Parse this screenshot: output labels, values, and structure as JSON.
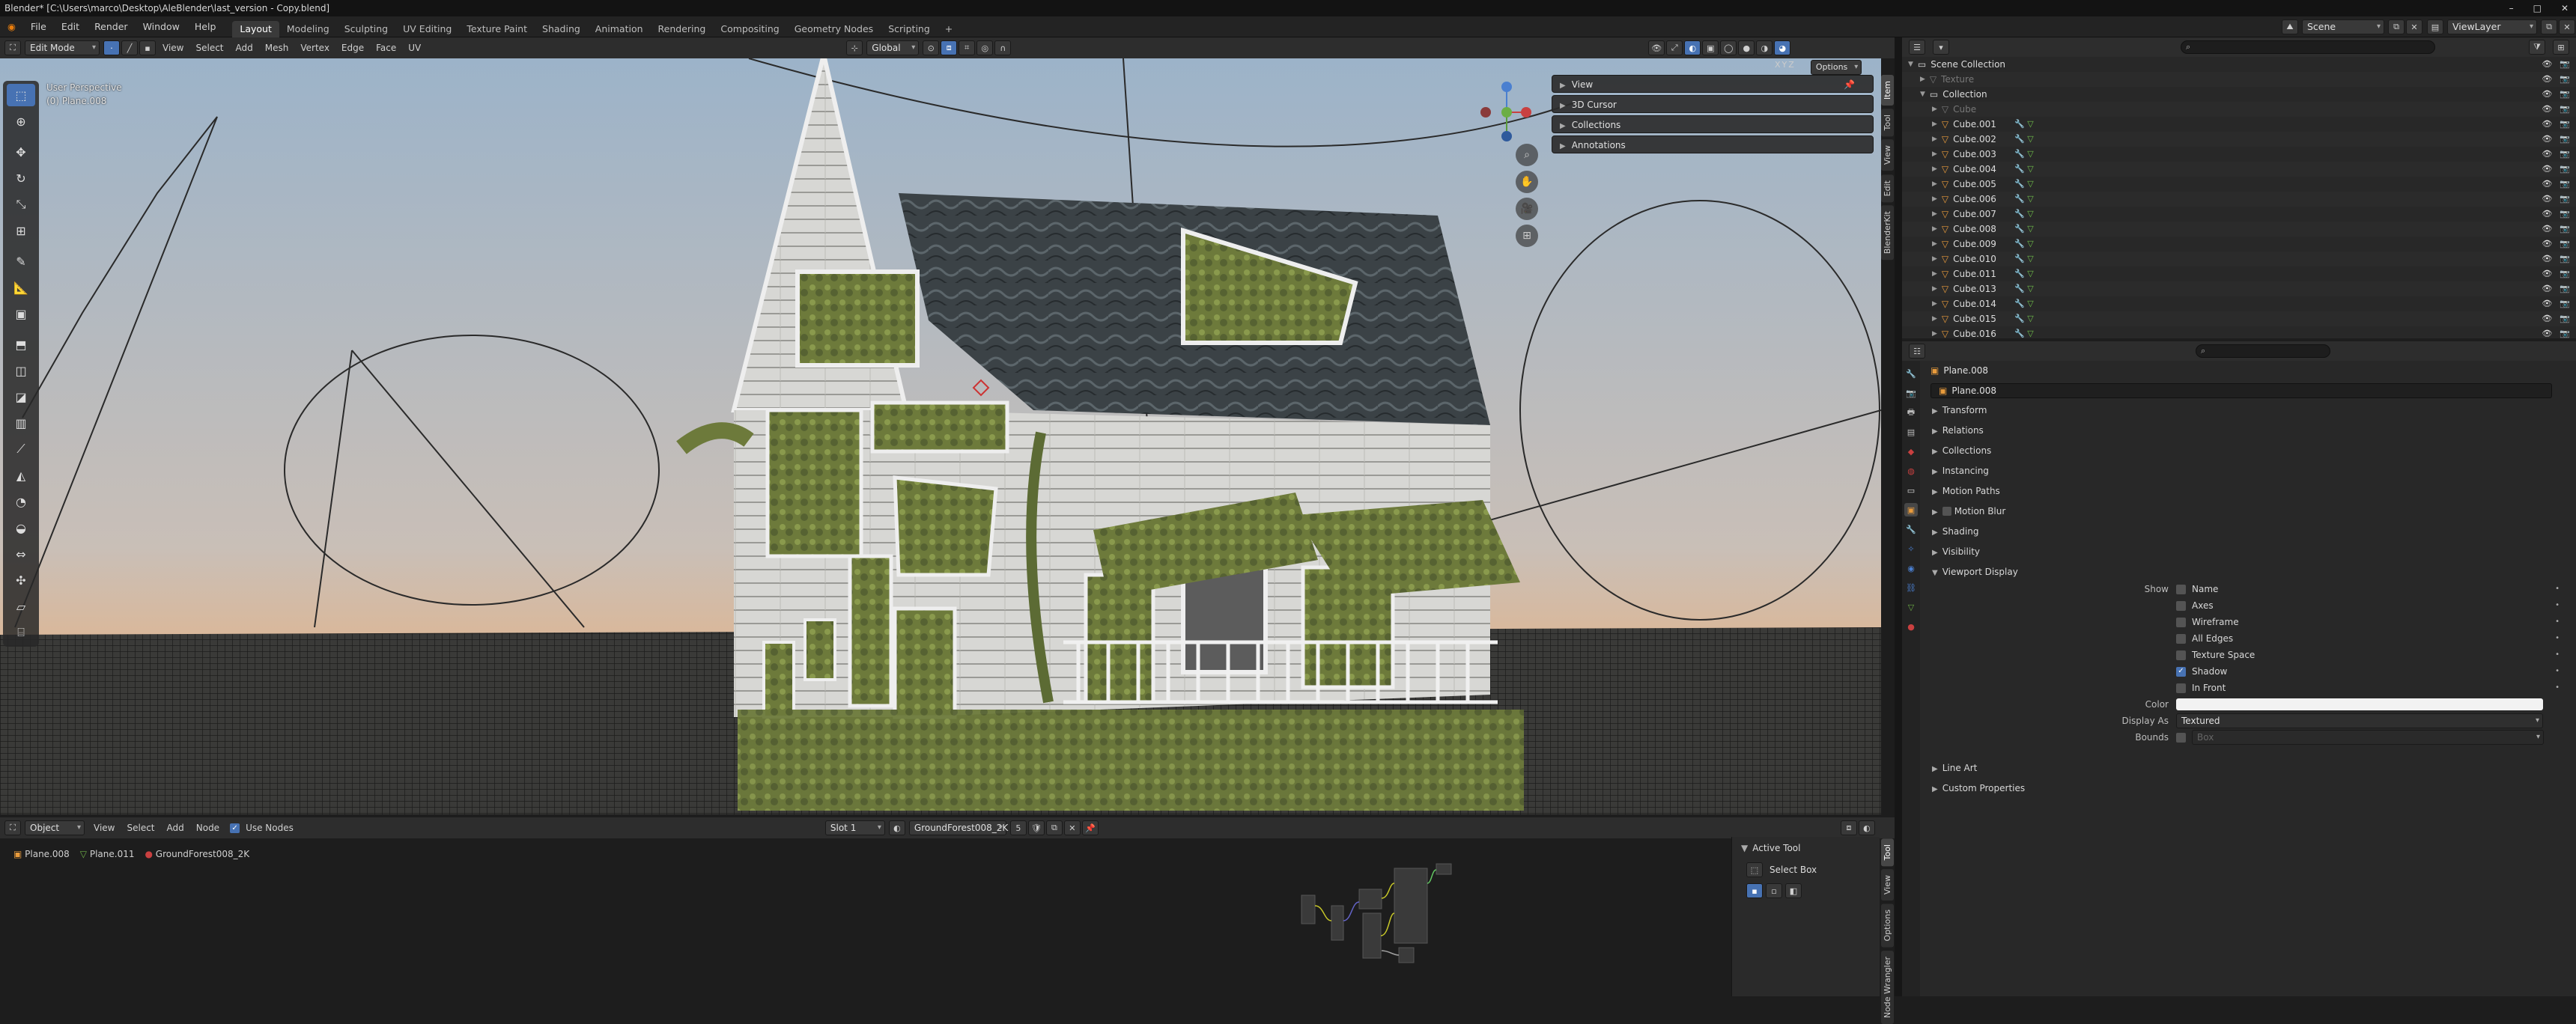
{
  "window": {
    "title": "Blender* [C:\\Users\\marco\\Desktop\\AleBlender\\last_version - Copy.blend]",
    "controls": [
      "–",
      "□",
      "✕"
    ]
  },
  "menu": [
    "File",
    "Edit",
    "Render",
    "Window",
    "Help"
  ],
  "workspaces": [
    "Layout",
    "Modeling",
    "Sculpting",
    "UV Editing",
    "Texture Paint",
    "Shading",
    "Animation",
    "Rendering",
    "Compositing",
    "Geometry Nodes",
    "Scripting",
    "+"
  ],
  "scene": {
    "scene_name": "Scene",
    "view_layer": "ViewLayer"
  },
  "viewport_header": {
    "mode": "Edit Mode",
    "menus": [
      "View",
      "Select",
      "Add",
      "Mesh",
      "Vertex",
      "Edge",
      "Face",
      "UV"
    ],
    "orientation": "Global",
    "options_label": "Options",
    "axes": [
      "X",
      "Y",
      "Z"
    ]
  },
  "viewport": {
    "view_name": "User Perspective",
    "object_label": "(0) Plane.008",
    "npanels": [
      "View",
      "3D Cursor",
      "Collections",
      "Annotations"
    ],
    "side_tabs": [
      "Item",
      "Tool",
      "View",
      "Edit",
      "BlenderKit"
    ]
  },
  "outliner": {
    "rows": [
      {
        "name": "Scene Collection",
        "indent": 0,
        "kind": "collection"
      },
      {
        "name": "Texture",
        "indent": 1,
        "kind": "dim"
      },
      {
        "name": "Collection",
        "indent": 1,
        "kind": "collection"
      },
      {
        "name": "Cube",
        "indent": 2,
        "kind": "dim"
      },
      {
        "name": "Cube.001",
        "indent": 2,
        "kind": "obj"
      },
      {
        "name": "Cube.002",
        "indent": 2,
        "kind": "obj"
      },
      {
        "name": "Cube.003",
        "indent": 2,
        "kind": "obj"
      },
      {
        "name": "Cube.004",
        "indent": 2,
        "kind": "obj"
      },
      {
        "name": "Cube.005",
        "indent": 2,
        "kind": "obj"
      },
      {
        "name": "Cube.006",
        "indent": 2,
        "kind": "obj"
      },
      {
        "name": "Cube.007",
        "indent": 2,
        "kind": "obj"
      },
      {
        "name": "Cube.008",
        "indent": 2,
        "kind": "obj"
      },
      {
        "name": "Cube.009",
        "indent": 2,
        "kind": "obj"
      },
      {
        "name": "Cube.010",
        "indent": 2,
        "kind": "obj"
      },
      {
        "name": "Cube.011",
        "indent": 2,
        "kind": "obj"
      },
      {
        "name": "Cube.013",
        "indent": 2,
        "kind": "obj"
      },
      {
        "name": "Cube.014",
        "indent": 2,
        "kind": "obj"
      },
      {
        "name": "Cube.015",
        "indent": 2,
        "kind": "obj"
      },
      {
        "name": "Cube.016",
        "indent": 2,
        "kind": "obj"
      }
    ]
  },
  "properties": {
    "object_name": "Plane.008",
    "name_field": "Plane.008",
    "sections": [
      "Transform",
      "Relations",
      "Collections",
      "Instancing",
      "Motion Paths",
      "Motion Blur",
      "Shading",
      "Visibility"
    ],
    "viewport_display": {
      "title": "Viewport Display",
      "show_label": "Show",
      "options": [
        {
          "label": "Name",
          "checked": false
        },
        {
          "label": "Axes",
          "checked": false
        },
        {
          "label": "Wireframe",
          "checked": false
        },
        {
          "label": "All Edges",
          "checked": false
        },
        {
          "label": "Texture Space",
          "checked": false
        },
        {
          "label": "Shadow",
          "checked": true
        },
        {
          "label": "In Front",
          "checked": false
        }
      ],
      "color_label": "Color",
      "color_value": "#f2f2f2",
      "display_as_label": "Display As",
      "display_as_value": "Textured",
      "bounds_label": "Bounds",
      "bounds_value": "Box"
    },
    "after_sections": [
      "Line Art",
      "Custom Properties"
    ]
  },
  "node_editor": {
    "type": "Object",
    "menus": [
      "View",
      "Select",
      "Add",
      "Node"
    ],
    "use_nodes_label": "Use Nodes",
    "slot": "Slot 1",
    "material": "GroundForest008_2K",
    "users": "5",
    "breadcrumb": [
      "Plane.008",
      "Plane.011",
      "GroundForest008_2K"
    ],
    "active_tool_title": "Active Tool",
    "active_tool_name": "Select Box",
    "side_tabs": [
      "Tool",
      "View",
      "Options",
      "Node Wrangler"
    ]
  },
  "colors": {
    "accent": "#4772b3",
    "object_orange": "#e89b3c",
    "modifier_green": "#6fbf4a",
    "sky_top": "#9cb3c9",
    "sky_bottom": "#c9bfb7"
  }
}
